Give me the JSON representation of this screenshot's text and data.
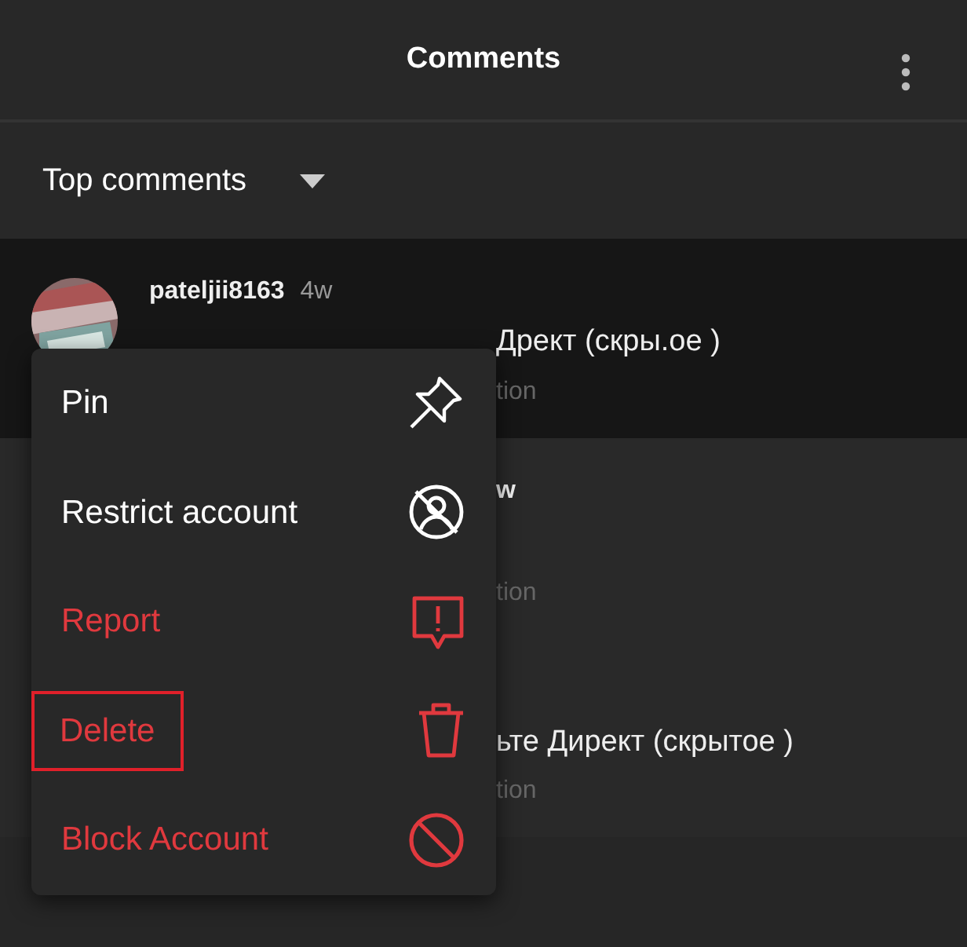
{
  "header": {
    "title": "Comments"
  },
  "sort": {
    "label": "Top comments"
  },
  "comments": [
    {
      "username": "pateljii8163",
      "age": "4w",
      "text_fragment": "Дрект (скры.ое )",
      "action": "tion",
      "focused": true
    },
    {
      "username_fragment": "w",
      "action": "tion",
      "focused": false
    },
    {
      "text_fragment": "ьте Директ (скрытое )",
      "action": "tion",
      "focused": false
    }
  ],
  "menu": [
    {
      "kind": "pin",
      "label": "Pin",
      "danger": false,
      "highlighted": false
    },
    {
      "kind": "restrict",
      "label": "Restrict account",
      "danger": false,
      "highlighted": false
    },
    {
      "kind": "report",
      "label": "Report",
      "danger": true,
      "highlighted": false
    },
    {
      "kind": "delete",
      "label": "Delete",
      "danger": true,
      "highlighted": true
    },
    {
      "kind": "block",
      "label": "Block Account",
      "danger": true,
      "highlighted": false
    }
  ]
}
